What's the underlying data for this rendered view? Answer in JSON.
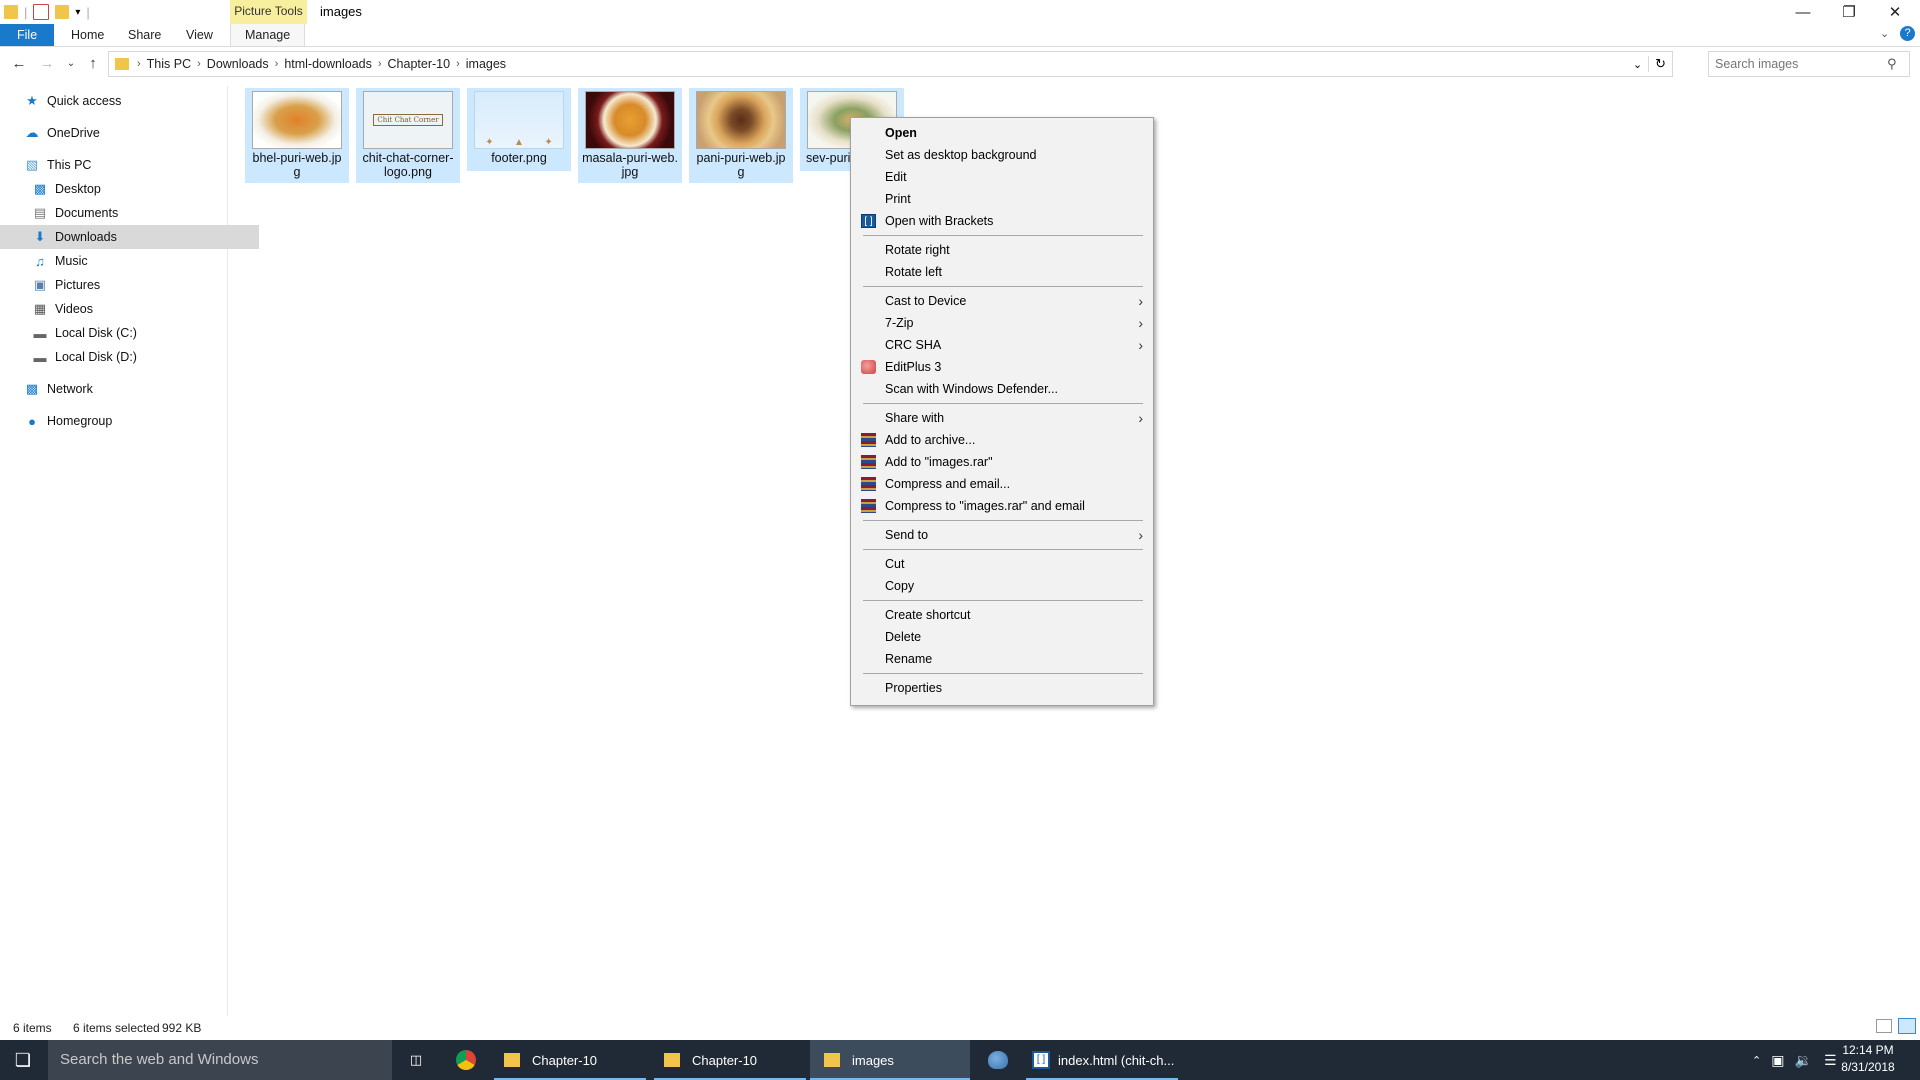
{
  "window": {
    "contextual_tab_group": "Picture Tools",
    "title": "images"
  },
  "ribbon": {
    "tabs": [
      "File",
      "Home",
      "Share",
      "View",
      "Manage"
    ]
  },
  "address": {
    "crumbs": [
      "This PC",
      "Downloads",
      "html-downloads",
      "Chapter-10",
      "images"
    ]
  },
  "search": {
    "placeholder": "Search images"
  },
  "sidebar": {
    "items": [
      {
        "label": "Quick access",
        "icon": "star-icon"
      },
      {
        "label": "OneDrive",
        "icon": "cloud-icon"
      },
      {
        "label": "This PC",
        "icon": "computer-icon"
      },
      {
        "label": "Desktop",
        "icon": "desktop-icon"
      },
      {
        "label": "Documents",
        "icon": "documents-icon"
      },
      {
        "label": "Downloads",
        "icon": "download-icon",
        "selected": true
      },
      {
        "label": "Music",
        "icon": "music-icon"
      },
      {
        "label": "Pictures",
        "icon": "pictures-icon"
      },
      {
        "label": "Videos",
        "icon": "videos-icon"
      },
      {
        "label": "Local Disk (C:)",
        "icon": "drive-icon"
      },
      {
        "label": "Local Disk (D:)",
        "icon": "drive-icon"
      },
      {
        "label": "Network",
        "icon": "network-icon"
      },
      {
        "label": "Homegroup",
        "icon": "homegroup-icon"
      }
    ]
  },
  "files": [
    {
      "name": "bhel-puri-web.jpg",
      "line1": "bhel-puri-web.jp",
      "line2": "g"
    },
    {
      "name": "chit-chat-corner-logo.png",
      "line1": "chit-chat-corner-",
      "line2": "logo.png",
      "logo_text": "Chit Chat Corner"
    },
    {
      "name": "footer.png",
      "line1": "footer.png",
      "line2": ""
    },
    {
      "name": "masala-puri-web.jpg",
      "line1": "masala-puri-web.",
      "line2": "jpg"
    },
    {
      "name": "pani-puri-web.jpg",
      "line1": "pani-puri-web.jp",
      "line2": "g"
    },
    {
      "name": "sev-puri",
      "line1": "sev-puri",
      "line2": ""
    }
  ],
  "context_menu": {
    "items": [
      {
        "label": "Open",
        "bold": true
      },
      {
        "label": "Set as desktop background"
      },
      {
        "label": "Edit"
      },
      {
        "label": "Print"
      },
      {
        "label": "Open with Brackets",
        "icon": "brackets-icon"
      },
      {
        "label": "Rotate right"
      },
      {
        "label": "Rotate left"
      },
      {
        "label": "Cast to Device",
        "submenu": true
      },
      {
        "label": "7-Zip",
        "submenu": true
      },
      {
        "label": "CRC SHA",
        "submenu": true
      },
      {
        "label": "EditPlus 3",
        "icon": "editplus-icon"
      },
      {
        "label": "Scan with Windows Defender..."
      },
      {
        "label": "Share with",
        "submenu": true
      },
      {
        "label": "Add to archive...",
        "icon": "winrar-icon"
      },
      {
        "label": "Add to \"images.rar\"",
        "icon": "winrar-icon"
      },
      {
        "label": "Compress and email...",
        "icon": "winrar-icon"
      },
      {
        "label": "Compress to \"images.rar\" and email",
        "icon": "winrar-icon"
      },
      {
        "label": "Send to",
        "submenu": true
      },
      {
        "label": "Cut"
      },
      {
        "label": "Copy"
      },
      {
        "label": "Create shortcut"
      },
      {
        "label": "Delete"
      },
      {
        "label": "Rename"
      },
      {
        "label": "Properties"
      }
    ]
  },
  "status": {
    "item_count": "6 items",
    "selected": "6 items selected",
    "size": "992 KB"
  },
  "taskbar": {
    "search_placeholder": "Search the web and Windows",
    "apps": [
      "Chapter-10",
      "Chapter-10",
      "images",
      "index.html (chit-ch..."
    ],
    "time": "12:14 PM",
    "date": "8/31/2018"
  },
  "colors": {
    "selection": "#cce8ff",
    "file_tab": "#1979ca",
    "picture_tools": "#f7ef9e",
    "taskbar": "#1f2a36"
  }
}
